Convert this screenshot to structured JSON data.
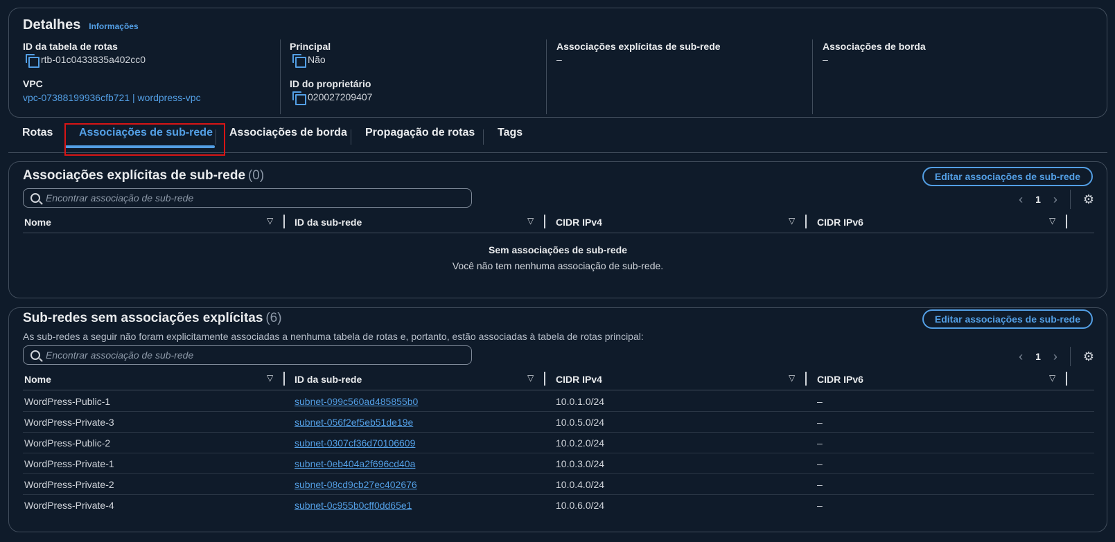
{
  "details": {
    "title": "Detalhes",
    "info_link": "Informações",
    "route_table_id_label": "ID da tabela de rotas",
    "route_table_id": "rtb-01c0433835a402cc0",
    "vpc_label": "VPC",
    "vpc_value": "vpc-07388199936cfb721 | wordpress-vpc",
    "principal_label": "Principal",
    "principal_value": "Não",
    "owner_label": "ID do proprietário",
    "owner_value": "020027209407",
    "explicit_assoc_label": "Associações explícitas de sub-rede",
    "explicit_assoc_value": "–",
    "edge_assoc_label": "Associações de borda",
    "edge_assoc_value": "–"
  },
  "tabs": [
    {
      "label": "Rotas"
    },
    {
      "label": "Associações de sub-rede"
    },
    {
      "label": "Associações de borda"
    },
    {
      "label": "Propagação de rotas"
    },
    {
      "label": "Tags"
    }
  ],
  "active_tab": "Associações de sub-rede",
  "explicit": {
    "title": "Associações explícitas de sub-rede",
    "count": "(0)",
    "edit_button": "Editar associações de sub-rede",
    "search_placeholder": "Encontrar associação de sub-rede",
    "page": "1",
    "columns": [
      "Nome",
      "ID da sub-rede",
      "CIDR IPv4",
      "CIDR IPv6"
    ],
    "empty_title": "Sem associações de sub-rede",
    "empty_text": "Você não tem nenhuma associação de sub-rede."
  },
  "unassociated": {
    "title": "Sub-redes sem associações explícitas",
    "count": "(6)",
    "description": "As sub-redes a seguir não foram explicitamente associadas a nenhuma tabela de rotas e, portanto, estão associadas à tabela de rotas principal:",
    "edit_button": "Editar associações de sub-rede",
    "search_placeholder": "Encontrar associação de sub-rede",
    "page": "1",
    "columns": [
      "Nome",
      "ID da sub-rede",
      "CIDR IPv4",
      "CIDR IPv6"
    ],
    "rows": [
      {
        "name": "WordPress-Public-1",
        "subnet_id": "subnet-099c560ad485855b0",
        "ipv4": "10.0.1.0/24",
        "ipv6": "–"
      },
      {
        "name": "WordPress-Private-3",
        "subnet_id": "subnet-056f2ef5eb51de19e",
        "ipv4": "10.0.5.0/24",
        "ipv6": "–"
      },
      {
        "name": "WordPress-Public-2",
        "subnet_id": "subnet-0307cf36d70106609",
        "ipv4": "10.0.2.0/24",
        "ipv6": "–"
      },
      {
        "name": "WordPress-Private-1",
        "subnet_id": "subnet-0eb404a2f696cd40a",
        "ipv4": "10.0.3.0/24",
        "ipv6": "–"
      },
      {
        "name": "WordPress-Private-2",
        "subnet_id": "subnet-08cd9cb27ec402676",
        "ipv4": "10.0.4.0/24",
        "ipv6": "–"
      },
      {
        "name": "WordPress-Private-4",
        "subnet_id": "subnet-0c955b0cff0dd65e1",
        "ipv4": "10.0.6.0/24",
        "ipv6": "–"
      }
    ]
  },
  "colors": {
    "accent": "#539fe5",
    "background": "#0f1b2a",
    "highlight": "#d91515"
  }
}
